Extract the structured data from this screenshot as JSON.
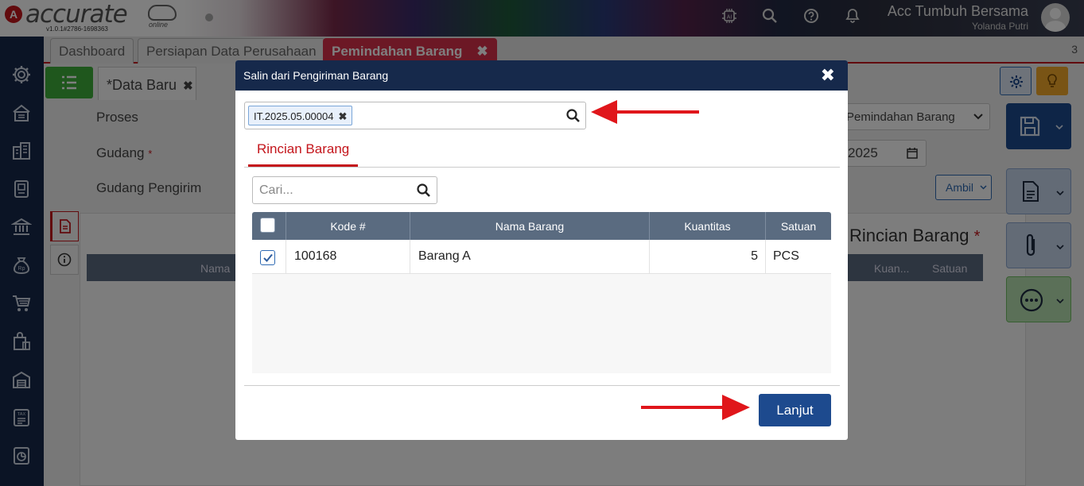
{
  "header": {
    "brand": "accurate",
    "brand_sub": "online",
    "version": "v1.0.1#2786-1698363",
    "company_name": "Acc Tumbuh Bersama",
    "user_name": "Yolanda Putri",
    "icons": [
      "ai-chip-icon",
      "search-icon",
      "help-icon",
      "bell-icon"
    ]
  },
  "sidebar": {
    "items": [
      "settings-icon",
      "company-icon",
      "building-icon",
      "ledger-icon",
      "bank-icon",
      "cash-bag-icon",
      "cart-icon",
      "shopping-bag-icon",
      "warehouse-icon",
      "tax-icon",
      "report-icon"
    ]
  },
  "tabs": {
    "items": [
      {
        "label": "Dashboard"
      },
      {
        "label": "Persiapan Data Perusahaan"
      },
      {
        "label": "Pemindahan Barang",
        "close": "✖"
      }
    ],
    "count": "3"
  },
  "form": {
    "subtab_prefix": "*",
    "subtab_label": "Data Baru",
    "subtab_close": "✖",
    "proses_label": "Proses",
    "gudang_label": "Gudang",
    "gudang_req": "*",
    "gudang_pengirim_label": "Gudang Pengirim",
    "proses_value": "Pemindahan Barang",
    "date_value": "2025",
    "ambil_label": "Ambil",
    "panel_title": "Rincian Barang",
    "panel_title_req": "*",
    "grid_cols": [
      "Nama",
      "Kuan...",
      "Satuan"
    ]
  },
  "modal": {
    "title": "Salin dari Pengiriman Barang",
    "close": "✖",
    "source_chip": "IT.2025.05.00004",
    "chip_remove": "✖",
    "tab_label": "Rincian Barang",
    "search_placeholder": "Cari...",
    "columns": [
      "Kode #",
      "Nama Barang",
      "Kuantitas",
      "Satuan"
    ],
    "rows": [
      {
        "checked": true,
        "kode": "100168",
        "nama": "Barang A",
        "kuantitas": "5",
        "satuan": "PCS"
      }
    ],
    "submit_label": "Lanjut"
  },
  "colors": {
    "navy": "#16294b",
    "accent_red": "#c4161c",
    "primary_blue": "#1d4a8e",
    "grid_header": "#5a6b80"
  }
}
